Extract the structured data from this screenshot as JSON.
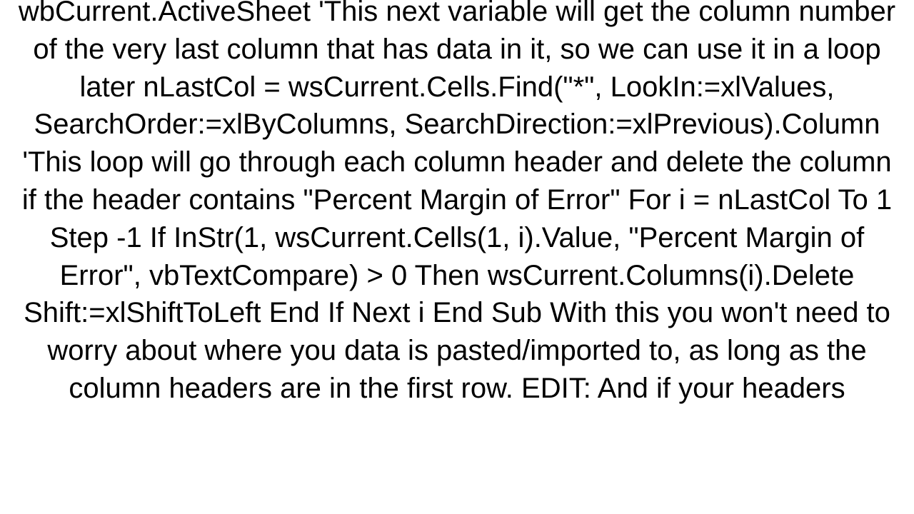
{
  "document": {
    "body": "wbCurrent.ActiveSheet 'This next variable will get the column number of the very last column that has data in it, so we can use it in a loop later nLastCol = wsCurrent.Cells.Find(\"*\", LookIn:=xlValues, SearchOrder:=xlByColumns, SearchDirection:=xlPrevious).Column  'This loop will go through each column header and delete the column if the header contains \"Percent Margin of Error\" For i = nLastCol To 1 Step -1      If InStr(1, wsCurrent.Cells(1, i).Value, \"Percent Margin of Error\", vbTextCompare) > 0 Then             wsCurrent.Columns(i).Delete Shift:=xlShiftToLeft      End If Next i  End Sub  With this you won't need to worry about where you data is pasted/imported to, as long as the column headers are in the first row. EDIT: And if your headers"
  }
}
